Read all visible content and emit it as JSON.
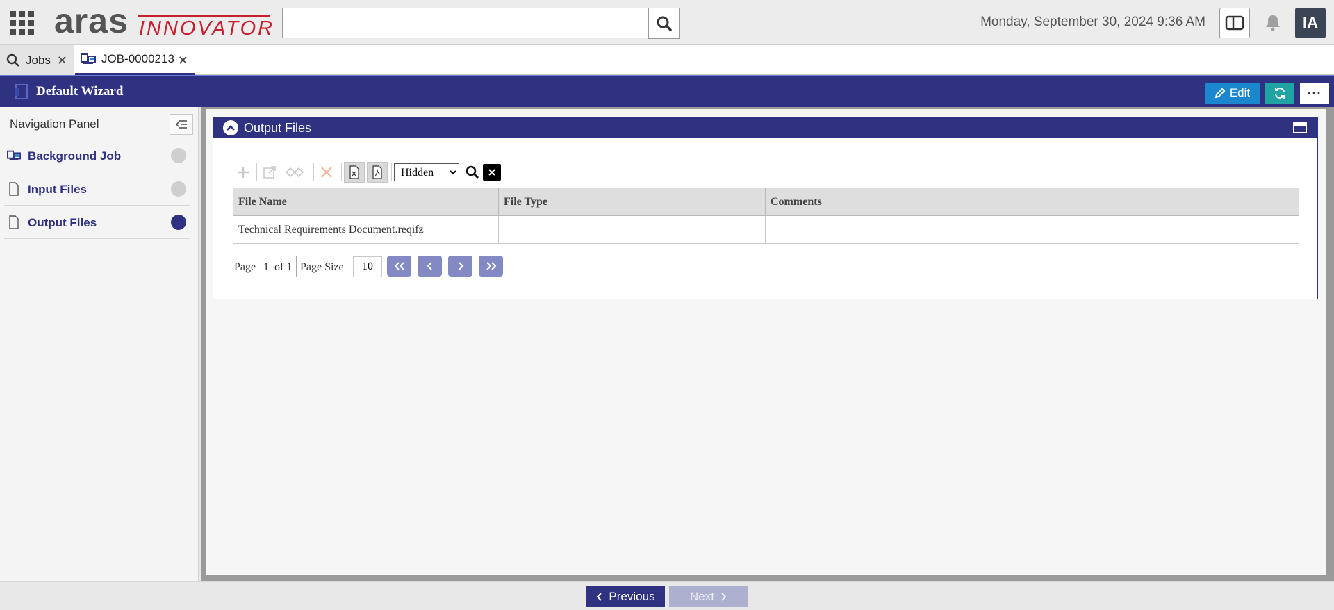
{
  "header": {
    "logo_primary": "aras",
    "logo_secondary": "INNOVATOR",
    "search_placeholder": "",
    "datetime": "Monday, September 30, 2024 9:36 AM",
    "avatar_initials": "IA"
  },
  "tabs": [
    {
      "label": "Jobs",
      "icon": "search-icon"
    },
    {
      "label": "JOB-0000213",
      "icon": "job-icon",
      "active": true
    }
  ],
  "wizard": {
    "title": "Default Wizard",
    "edit_label": "Edit",
    "more_label": "···"
  },
  "nav": {
    "title": "Navigation Panel",
    "items": [
      {
        "label": "Background Job",
        "icon": "job-icon",
        "status": "incomplete"
      },
      {
        "label": "Input Files",
        "icon": "file-icon",
        "status": "incomplete"
      },
      {
        "label": "Output Files",
        "icon": "file-icon",
        "status": "active"
      }
    ]
  },
  "panel": {
    "title": "Output Files",
    "filter_value": "Hidden",
    "filter_options": [
      "Hidden"
    ],
    "columns": [
      "File Name",
      "File Type",
      "Comments"
    ],
    "rows": [
      [
        "Technical Requirements Document.reqifz",
        "",
        ""
      ]
    ],
    "pager": {
      "page_label": "Page",
      "page": "1",
      "of_label": "of 1",
      "size_label": "Page Size",
      "size": "10"
    }
  },
  "footer": {
    "prev_label": "Previous",
    "next_label": "Next"
  },
  "colors": {
    "brand": "#2f3181",
    "edit": "#1a87cf",
    "refresh": "#1fa3a3",
    "logo_red": "#c8202f"
  }
}
